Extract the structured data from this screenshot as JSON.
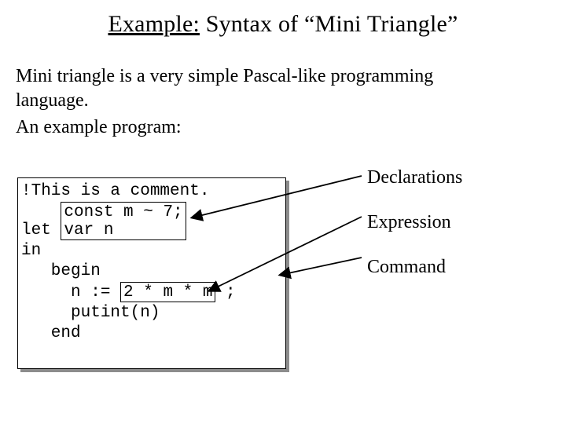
{
  "title": {
    "underlined": "Example:",
    "rest": " Syntax of “Mini Triangle”"
  },
  "intro_line1": "Mini triangle is a very simple Pascal-like programming",
  "intro_line2": "language.",
  "intro2": "An example program:",
  "labels": {
    "declarations": "Declarations",
    "expression": "Expression",
    "command": "Command"
  },
  "code": {
    "l1": "!This is a comment.",
    "l2a": "let ",
    "l2_boxed": "const m ~ 7;",
    "l3_indent": "    ",
    "l3_boxed2": "var n",
    "l4": "in",
    "l5": "   begin",
    "l6a": "     n := ",
    "l6_boxed": "2 * m * m",
    "l6b": " ;",
    "l7": "     putint(n)",
    "l8": "   end"
  }
}
